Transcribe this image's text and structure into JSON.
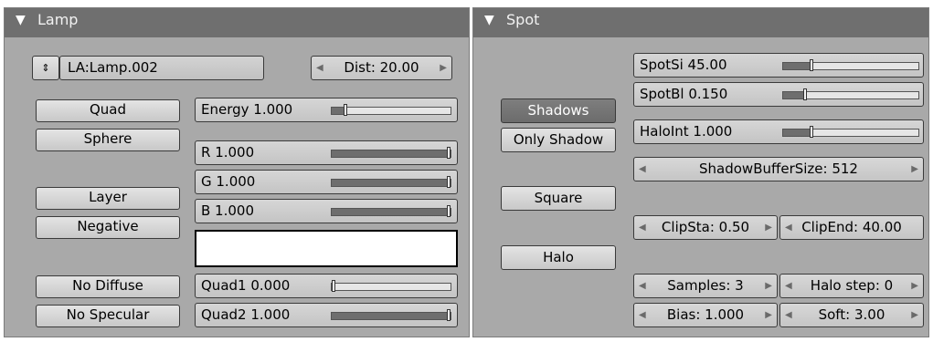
{
  "lamp_panel": {
    "title": "Lamp",
    "lamp_name": "LA:Lamp.002",
    "dist": "Dist: 20.00",
    "buttons": {
      "quad": "Quad",
      "sphere": "Sphere",
      "layer": "Layer",
      "negative": "Negative",
      "no_diffuse": "No Diffuse",
      "no_specular": "No Specular"
    },
    "sliders": {
      "energy": {
        "label": "Energy 1.000",
        "value": 0.1
      },
      "r": {
        "label": "R 1.000",
        "value": 1.0
      },
      "g": {
        "label": "G 1.000",
        "value": 1.0
      },
      "b": {
        "label": "B 1.000",
        "value": 1.0
      },
      "quad1": {
        "label": "Quad1 0.000",
        "value": 0.0
      },
      "quad2": {
        "label": "Quad2 1.000",
        "value": 1.0
      }
    },
    "color_swatch": "#ffffff"
  },
  "spot_panel": {
    "title": "Spot",
    "buttons": {
      "shadows": "Shadows",
      "only_shadow": "Only Shadow",
      "square": "Square",
      "halo": "Halo"
    },
    "sliders": {
      "spot_si": {
        "label": "SpotSi 45.00",
        "value": 0.2
      },
      "spot_bl": {
        "label": "SpotBl 0.150",
        "value": 0.15
      },
      "halo_int": {
        "label": "HaloInt 1.000",
        "value": 0.2
      }
    },
    "fields": {
      "shadow_buffer_size": "ShadowBufferSize: 512",
      "clip_sta": "ClipSta: 0.50",
      "clip_end": "ClipEnd: 40.00",
      "samples": "Samples: 3",
      "halo_step": "Halo step: 0",
      "bias": "Bias: 1.000",
      "soft": "Soft: 3.00"
    }
  },
  "icons": {
    "collapse": "triangle-down-icon",
    "browse": "up-down-arrows-icon",
    "decrement": "arrow-left-icon",
    "increment": "arrow-right-icon"
  }
}
